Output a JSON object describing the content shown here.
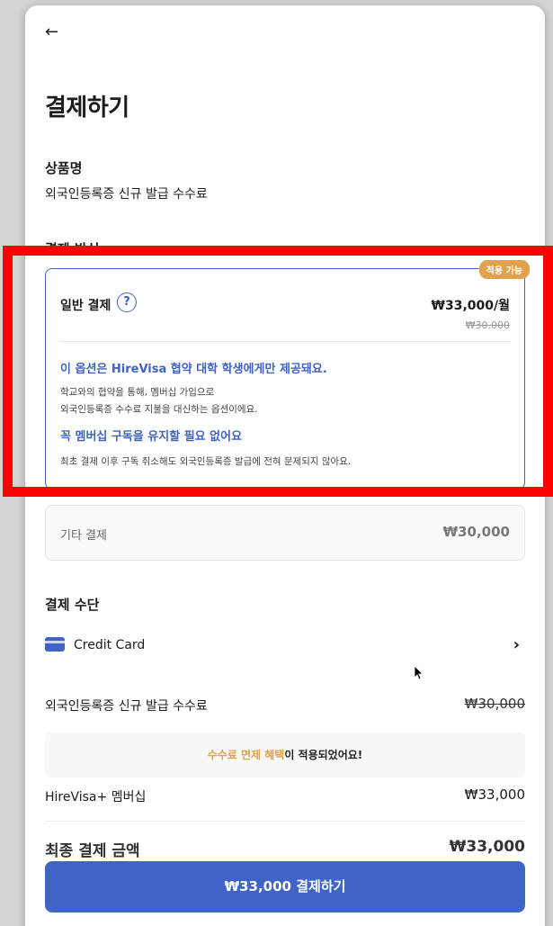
{
  "header": {
    "back_icon": "←",
    "title": "결제하기"
  },
  "product": {
    "section_title": "상품명",
    "name": "외국인등록증 신규 발급 수수료"
  },
  "payment_option": {
    "section_title": "결제 방식",
    "membership": {
      "badge": "적용 가능",
      "label": "일반 결제",
      "help_icon": "?",
      "price": "₩33,000/월",
      "old_price": "₩30,000",
      "headline": "이 옵션은 HireVisa 협약 대학 학생에게만 제공돼요.",
      "desc_line1": "학교와의 협약을 통해, 멤버십 가입으로",
      "desc_line2": "외국인등록증 수수료 지불을 대신하는 옵션이에요.",
      "subheadline": "꼭 멤버십 구독을 유지할 필요 없어요",
      "desc_line3": "최초 결제 이후 구독 취소해도 외국인등록증 발급에 전혀 문제되지 않아요."
    },
    "other": {
      "label": "기타 결제",
      "price": "₩30,000"
    }
  },
  "payment_method": {
    "section_title": "결제 수단",
    "label": "Credit Card",
    "chevron": "›"
  },
  "summary": {
    "fee_label": "외국인등록증 신규 발급 수수료",
    "fee_value": "₩30,000",
    "benefit_accent": "수수료 면제 혜택",
    "benefit_rest": "이 적용되었어요!",
    "membership_label": "HireVisa+ 멤버십",
    "membership_value": "₩33,000",
    "total_label": "최종 결제 금액",
    "total_value": "₩33,000"
  },
  "pay_button": {
    "label": "₩33,000 결제하기"
  },
  "colors": {
    "primary": "#3f63c6",
    "badge": "#e2a14c",
    "highlight": "#ff0000"
  }
}
